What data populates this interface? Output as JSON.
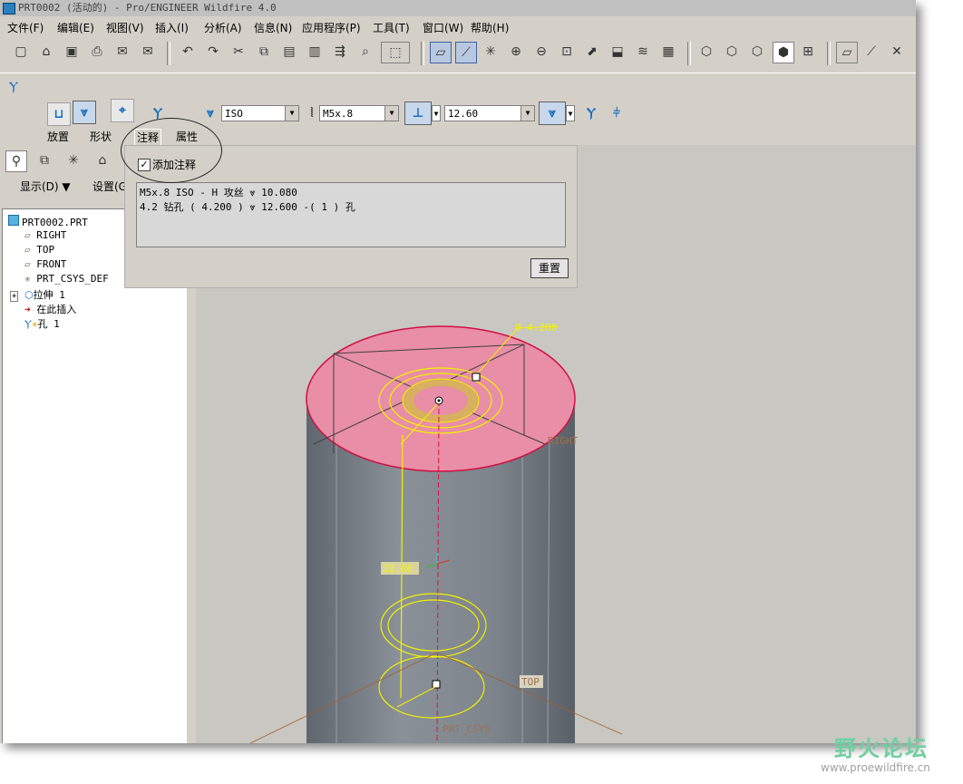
{
  "window": {
    "title": "PRT0002 (活动的) - Pro/ENGINEER Wildfire 4.0"
  },
  "menu": [
    "文件(F)",
    "编辑(E)",
    "视图(V)",
    "插入(I)",
    "分析(A)",
    "信息(N)",
    "应用程序(P)",
    "工具(T)",
    "窗口(W)",
    "帮助(H)"
  ],
  "dashboard": {
    "standard": "ISO",
    "screw_size": "M5x.8",
    "depth": "12.60",
    "tabs": [
      "放置",
      "形状",
      "注释",
      "属性"
    ],
    "active_tab": "注释"
  },
  "notes_panel": {
    "add_note_label": "添加注释",
    "add_note_checked": true,
    "lines": [
      "M5x.8 ISO - H 攻丝 ⩔ 10.080",
      "4.2 钻孔 ( 4.200 ) ⩔ 12.600  -( 1 ) 孔"
    ],
    "reset_label": "重置"
  },
  "tree": {
    "display_label": "显示(D) ▼",
    "settings_label": "设置(G",
    "items": [
      "PRT0002.PRT",
      "RIGHT",
      "TOP",
      "FRONT",
      "PRT_CSYS_DEF",
      "拉伸 1",
      "在此插入",
      "孔 1"
    ]
  },
  "viewport": {
    "dim_diameter": "Ø 4.200",
    "dim_depth": "12.60",
    "datum_right": "RIGHT",
    "datum_top": "TOP",
    "csys": "PRT_CSYS",
    "colors": {
      "top_face": "#e88ea6",
      "cylinder": "#7d848c",
      "sketch": "#f2f200"
    }
  },
  "watermark": {
    "title": "野火论坛",
    "url": "www.proewildfire.cn"
  }
}
